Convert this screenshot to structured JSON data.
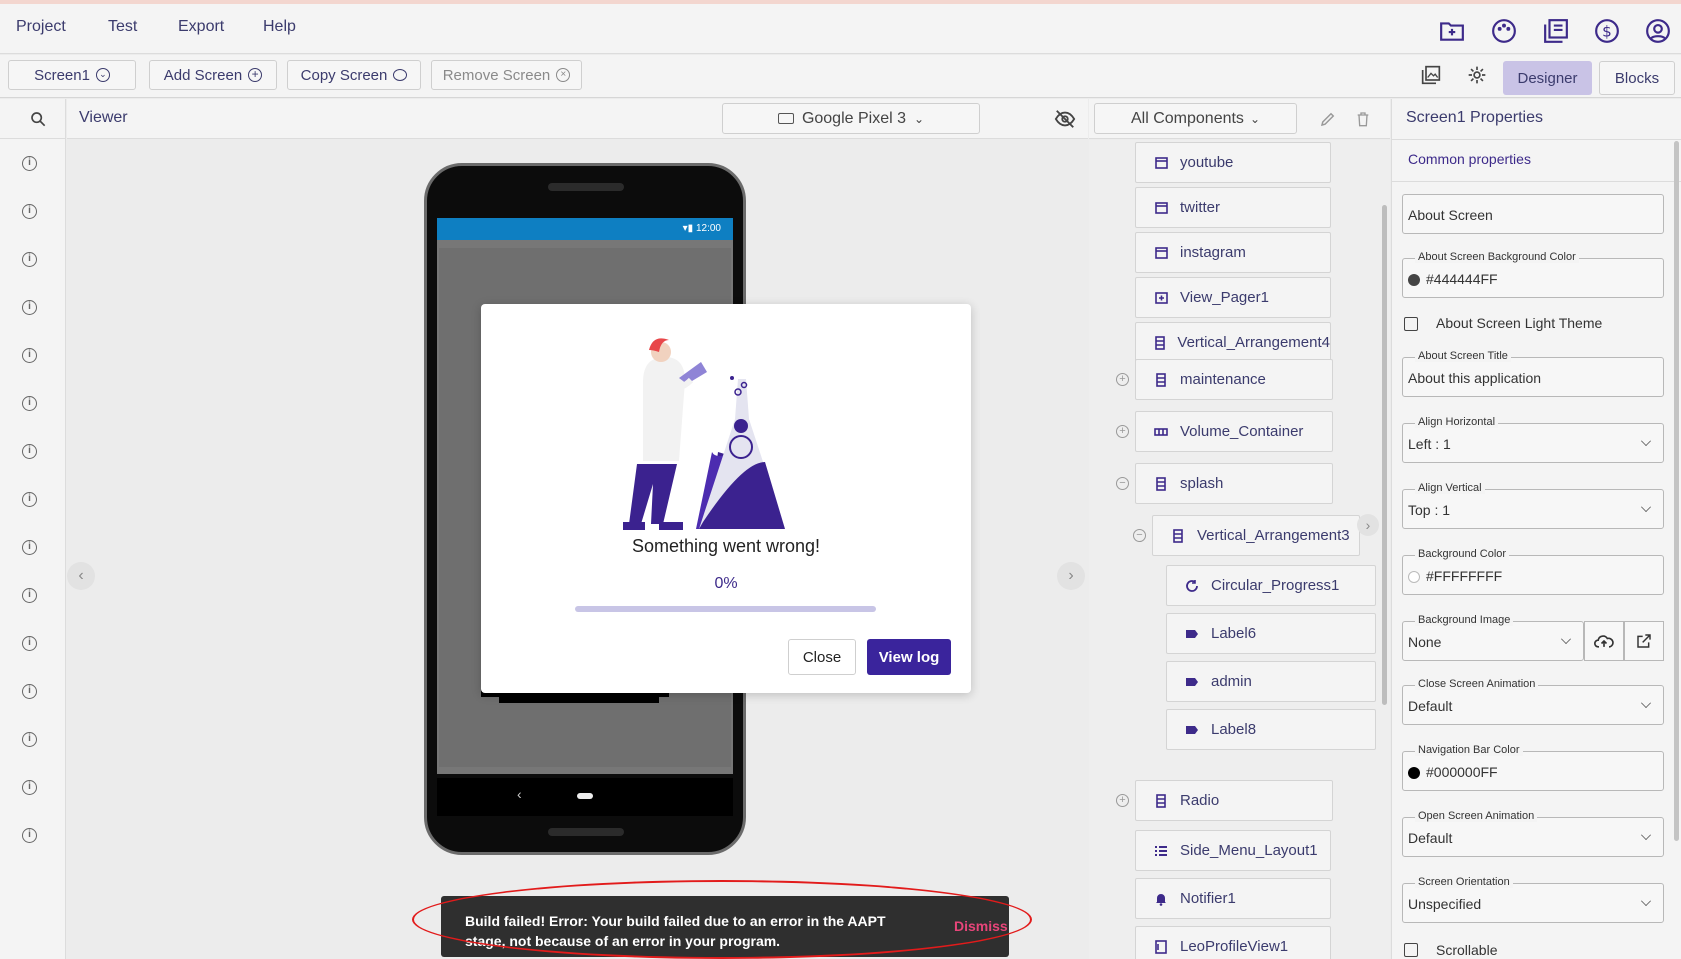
{
  "menubar": {
    "items": [
      "Project",
      "Test",
      "Export",
      "Help"
    ],
    "icons": [
      "folder-icon",
      "palette-icon",
      "library-icon",
      "dollar-icon",
      "account-icon"
    ]
  },
  "toolbar": {
    "screen_select": "Screen1",
    "add_screen": "Add Screen",
    "copy_screen": "Copy Screen",
    "remove_screen": "Remove Screen",
    "designer": "Designer",
    "blocks": "Blocks"
  },
  "viewer": {
    "title": "Viewer",
    "device": "Google Pixel 3",
    "phone_time": "12:00"
  },
  "components": {
    "filter": "All Components",
    "tree": [
      {
        "label": "youtube",
        "icon": "window-icon"
      },
      {
        "label": "twitter",
        "icon": "window-icon"
      },
      {
        "label": "instagram",
        "icon": "window-icon"
      },
      {
        "label": "View_Pager1",
        "icon": "pager-icon"
      },
      {
        "label": "Vertical_Arrangement4",
        "icon": "vertical-arrangement-icon"
      },
      {
        "label": "maintenance",
        "icon": "vertical-arrangement-icon",
        "toggle": "+"
      },
      {
        "label": "Volume_Container",
        "icon": "horizontal-arrangement-icon",
        "toggle": "+"
      },
      {
        "label": "splash",
        "icon": "vertical-arrangement-icon",
        "toggle": "−"
      },
      {
        "label": "Vertical_Arrangement3",
        "icon": "vertical-arrangement-icon",
        "toggle": "−"
      },
      {
        "label": "Circular_Progress1",
        "icon": "circular-progress-icon"
      },
      {
        "label": "Label6",
        "icon": "label-icon"
      },
      {
        "label": "admin",
        "icon": "label-icon"
      },
      {
        "label": "Label8",
        "icon": "label-icon"
      },
      {
        "label": "Radio",
        "icon": "vertical-arrangement-icon",
        "toggle": "+"
      },
      {
        "label": "Side_Menu_Layout1",
        "icon": "list-icon"
      },
      {
        "label": "Notifier1",
        "icon": "bell-icon"
      },
      {
        "label": "LeoProfileView1",
        "icon": "profile-icon"
      }
    ]
  },
  "properties": {
    "title": "Screen1 Properties",
    "tab": "Common properties",
    "about_screen": "About Screen",
    "about_bg_label": "About Screen Background Color",
    "about_bg_value": "#444444FF",
    "about_bg_color": "#444444",
    "light_theme": "About Screen Light Theme",
    "about_title_label": "About Screen Title",
    "about_title_value": "About this application",
    "align_h_label": "Align Horizontal",
    "align_h_value": "Left : 1",
    "align_v_label": "Align Vertical",
    "align_v_value": "Top : 1",
    "bg_color_label": "Background Color",
    "bg_color_value": "#FFFFFFFF",
    "bg_color": "#FFFFFF",
    "bg_image_label": "Background Image",
    "bg_image_value": "None",
    "close_anim_label": "Close Screen Animation",
    "close_anim_value": "Default",
    "nav_color_label": "Navigation Bar Color",
    "nav_color_value": "#000000FF",
    "nav_color": "#000000",
    "open_anim_label": "Open Screen Animation",
    "open_anim_value": "Default",
    "orientation_label": "Screen Orientation",
    "orientation_value": "Unspecified",
    "scrollable": "Scrollable"
  },
  "dialog": {
    "message": "Something went wrong!",
    "percent": "0%",
    "progress": 0,
    "close": "Close",
    "view_log": "View log"
  },
  "toast": {
    "text": "Build failed! Error: Your build failed due to an error in the AAPT stage, not because of an error in your program.",
    "dismiss": "Dismiss"
  },
  "colors": {
    "accent": "#3D2A8A",
    "dismiss": "#E8457A",
    "designer_bg": "#C9C3E6"
  }
}
